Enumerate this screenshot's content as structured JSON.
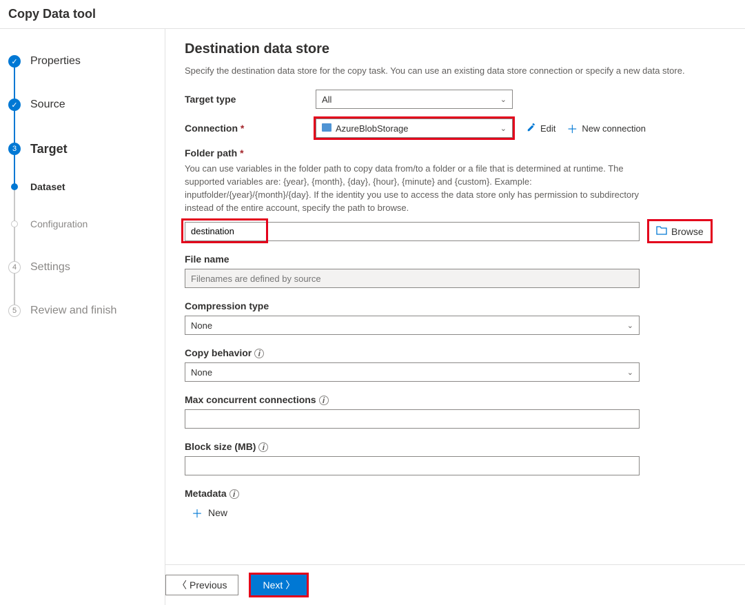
{
  "header": {
    "title": "Copy Data tool"
  },
  "sidebar": {
    "steps": [
      {
        "label": "Properties"
      },
      {
        "label": "Source"
      },
      {
        "label": "Target",
        "num": "3"
      },
      {
        "label": "Dataset"
      },
      {
        "label": "Configuration"
      },
      {
        "label": "Settings",
        "num": "4"
      },
      {
        "label": "Review and finish",
        "num": "5"
      }
    ]
  },
  "page": {
    "title": "Destination data store",
    "desc": "Specify the destination data store for the copy task. You can use an existing data store connection or specify a new data store."
  },
  "fields": {
    "target_type": {
      "label": "Target type",
      "value": "All"
    },
    "connection": {
      "label": "Connection",
      "value": "AzureBlobStorage",
      "edit": "Edit",
      "new": "New connection"
    },
    "folder_path": {
      "label": "Folder path",
      "help": "You can use variables in the folder path to copy data from/to a folder or a file that is determined at runtime. The supported variables are: {year}, {month}, {day}, {hour}, {minute} and {custom}. Example: inputfolder/{year}/{month}/{day}. If the identity you use to access the data store only has permission to subdirectory instead of the entire account, specify the path to browse.",
      "value": "destination",
      "browse": "Browse"
    },
    "file_name": {
      "label": "File name",
      "placeholder": "Filenames are defined by source"
    },
    "compression": {
      "label": "Compression type",
      "value": "None"
    },
    "copy_behavior": {
      "label": "Copy behavior",
      "value": "None"
    },
    "max_conn": {
      "label": "Max concurrent connections",
      "value": ""
    },
    "block_size": {
      "label": "Block size (MB)",
      "value": ""
    },
    "metadata": {
      "label": "Metadata",
      "new": "New"
    }
  },
  "footer": {
    "previous": "Previous",
    "next": "Next"
  }
}
